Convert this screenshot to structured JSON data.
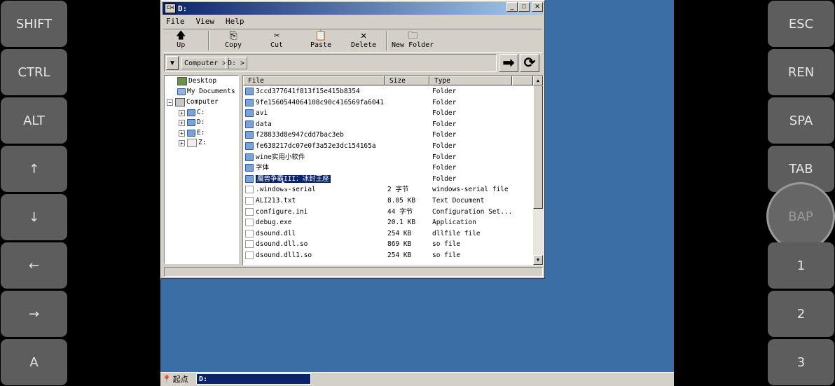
{
  "left_keys": [
    "SHIFT",
    "CTRL",
    "ALT",
    "↑",
    "↓",
    "←",
    "→",
    "A"
  ],
  "right_keys": [
    "ESC",
    "REN",
    "SPA",
    "TAB",
    "BAP",
    "1",
    "2",
    "3"
  ],
  "window": {
    "title": "D:",
    "icon_label": "CH",
    "buttons": {
      "minimize": "_",
      "maximize": "□",
      "close": "✕"
    }
  },
  "menu": [
    "File",
    "View",
    "Help"
  ],
  "toolbar": {
    "up": "Up",
    "copy": "Copy",
    "cut": "Cut",
    "paste": "Paste",
    "delete": "Delete",
    "new_folder": "New Folder"
  },
  "address": {
    "dropdown": "▼",
    "crumbs": [
      "Computer >",
      "D: >"
    ],
    "go": "➡",
    "refresh": "⟳"
  },
  "tree": {
    "desktop": "Desktop",
    "my_documents": "My Documents",
    "computer": "Computer",
    "drives": [
      "C:",
      "D:",
      "E:",
      "Z:"
    ]
  },
  "list": {
    "headers": {
      "file": "File",
      "size": "Size",
      "type": "Type"
    },
    "rows": [
      {
        "name": "3ccd377641f813f15e415b8354",
        "size": "",
        "type": "Folder",
        "kind": "folder"
      },
      {
        "name": "9fe1560544064108c90c416569fa6041",
        "size": "",
        "type": "Folder",
        "kind": "folder"
      },
      {
        "name": "avi",
        "size": "",
        "type": "Folder",
        "kind": "folder"
      },
      {
        "name": "data",
        "size": "",
        "type": "Folder",
        "kind": "folder"
      },
      {
        "name": "f28833d8e947cdd7bac3eb",
        "size": "",
        "type": "Folder",
        "kind": "folder"
      },
      {
        "name": "fe638217dc07e0f3a52e3dc154165a",
        "size": "",
        "type": "Folder",
        "kind": "folder"
      },
      {
        "name": "wine实用小软件",
        "size": "",
        "type": "Folder",
        "kind": "folder"
      },
      {
        "name": "字体",
        "size": "",
        "type": "Folder",
        "kind": "folder"
      },
      {
        "name": "魔兽争霸III：冰封王座",
        "size": "",
        "type": "Folder",
        "kind": "folder",
        "selected": true
      },
      {
        "name": ".windows-serial",
        "size": "2 字节",
        "type": "windows-serial file",
        "kind": "file"
      },
      {
        "name": "ALI213.txt",
        "size": "8.05 KB",
        "type": "Text Document",
        "kind": "file"
      },
      {
        "name": "configure.ini",
        "size": "44 字节",
        "type": "Configuration Set...",
        "kind": "file"
      },
      {
        "name": "debug.exe",
        "size": "20.1 KB",
        "type": "Application",
        "kind": "file"
      },
      {
        "name": "dsound.dll",
        "size": "254 KB",
        "type": "dllfile file",
        "kind": "file"
      },
      {
        "name": "dsound.dll.so",
        "size": "869 KB",
        "type": "so file",
        "kind": "file"
      },
      {
        "name": "dsound.dll1.so",
        "size": "254 KB",
        "type": "so file",
        "kind": "file"
      }
    ]
  },
  "taskbar": {
    "start": "起点",
    "active_item": "D:"
  },
  "colors": {
    "desktop": "#3a6ea5",
    "selection": "#0a246a",
    "key_bg": "#5d5d5d"
  }
}
